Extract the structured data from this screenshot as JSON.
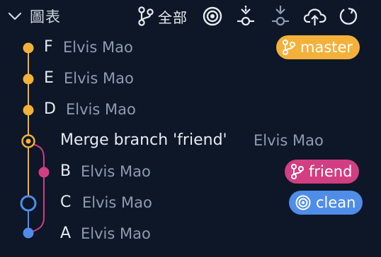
{
  "header": {
    "title": "圖表",
    "all_label": "全部"
  },
  "commits": [
    {
      "name": "F",
      "author": "Elvis Mao",
      "ref": "master"
    },
    {
      "name": "E",
      "author": "Elvis Mao"
    },
    {
      "name": "D",
      "author": "Elvis Mao"
    },
    {
      "name": "Merge branch 'friend'",
      "author": "Elvis Mao"
    },
    {
      "name": "B",
      "author": "Elvis Mao",
      "ref": "friend"
    },
    {
      "name": "C",
      "author": "Elvis Mao",
      "ref": "clean"
    },
    {
      "name": "A",
      "author": "Elvis Mao"
    }
  ],
  "colors": {
    "background": "#0d1727",
    "master": "#f4b13a",
    "friend": "#d23e82",
    "clean": "#4f8de8"
  }
}
